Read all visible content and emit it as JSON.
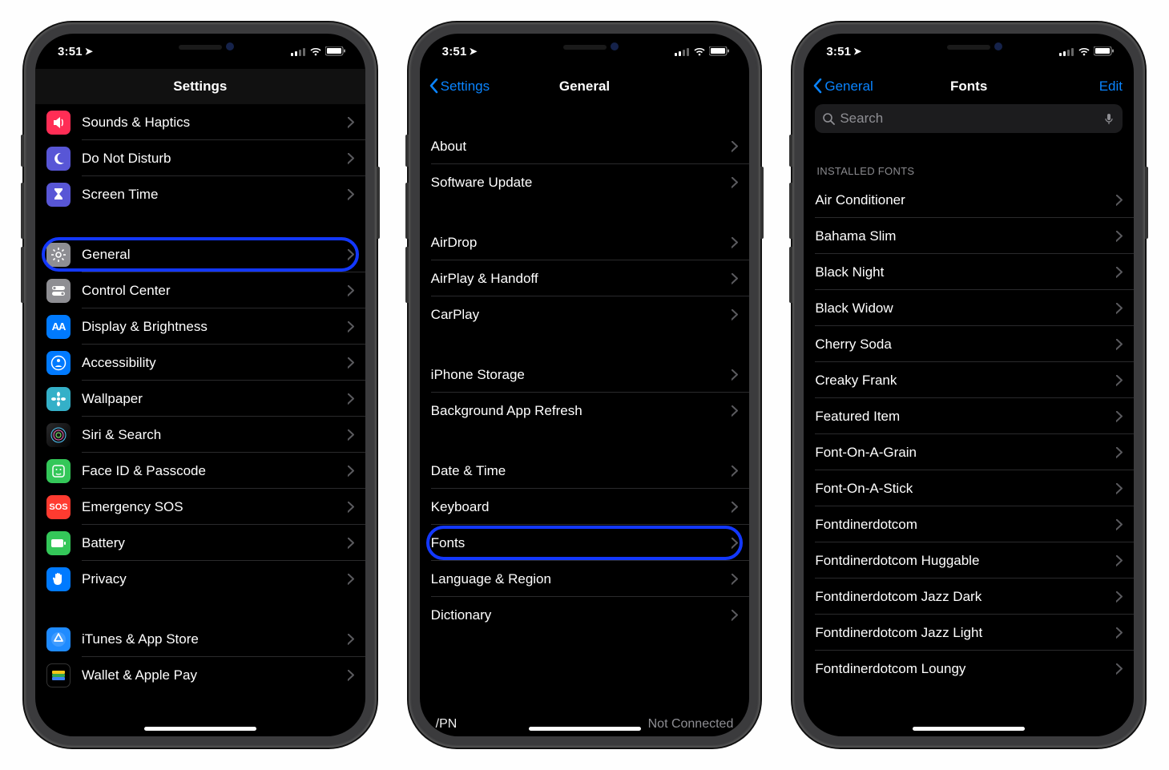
{
  "status": {
    "time": "3:51",
    "location_icon": "↗"
  },
  "phone1": {
    "title": "Settings",
    "groups": [
      {
        "rows": [
          {
            "label": "Sounds & Haptics",
            "icon": "sounds",
            "bg": "ic-sounds"
          },
          {
            "label": "Do Not Disturb",
            "icon": "moon",
            "bg": "ic-moon"
          },
          {
            "label": "Screen Time",
            "icon": "hourglass",
            "bg": "ic-hourglass"
          }
        ]
      },
      {
        "rows": [
          {
            "label": "General",
            "icon": "gear",
            "bg": "ic-gray",
            "highlight": true
          },
          {
            "label": "Control Center",
            "icon": "switches",
            "bg": "ic-gray"
          },
          {
            "label": "Display & Brightness",
            "icon": "AA",
            "bg": "ic-blue"
          },
          {
            "label": "Accessibility",
            "icon": "person",
            "bg": "ic-blue"
          },
          {
            "label": "Wallpaper",
            "icon": "flower",
            "bg": "ic-wall"
          },
          {
            "label": "Siri & Search",
            "icon": "siri",
            "bg": "ic-siri"
          },
          {
            "label": "Face ID & Passcode",
            "icon": "face",
            "bg": "ic-green"
          },
          {
            "label": "Emergency SOS",
            "icon": "SOS",
            "bg": "ic-redsos"
          },
          {
            "label": "Battery",
            "icon": "battery",
            "bg": "ic-green"
          },
          {
            "label": "Privacy",
            "icon": "hand",
            "bg": "ic-hand"
          }
        ]
      },
      {
        "rows": [
          {
            "label": "iTunes & App Store",
            "icon": "appstore",
            "bg": "ic-appstore"
          },
          {
            "label": "Wallet & Apple Pay",
            "icon": "wallet",
            "bg": "ic-wallet"
          }
        ]
      }
    ]
  },
  "phone2": {
    "back": "Settings",
    "title": "General",
    "groups": [
      {
        "rows": [
          {
            "label": "About"
          },
          {
            "label": "Software Update"
          }
        ]
      },
      {
        "rows": [
          {
            "label": "AirDrop"
          },
          {
            "label": "AirPlay & Handoff"
          },
          {
            "label": "CarPlay"
          }
        ]
      },
      {
        "rows": [
          {
            "label": "iPhone Storage"
          },
          {
            "label": "Background App Refresh"
          }
        ]
      },
      {
        "rows": [
          {
            "label": "Date & Time"
          },
          {
            "label": "Keyboard"
          },
          {
            "label": "Fonts",
            "highlight": true
          },
          {
            "label": "Language & Region"
          },
          {
            "label": "Dictionary"
          }
        ]
      }
    ],
    "clipped_left": "/PN",
    "clipped_right": "Not Connected"
  },
  "phone3": {
    "back": "General",
    "title": "Fonts",
    "edit": "Edit",
    "search_placeholder": "Search",
    "header": "INSTALLED FONTS",
    "fonts": [
      "Air Conditioner",
      "Bahama Slim",
      "Black Night",
      "Black Widow",
      "Cherry Soda",
      "Creaky Frank",
      "Featured Item",
      "Font-On-A-Grain",
      "Font-On-A-Stick",
      "Fontdinerdotcom",
      "Fontdinerdotcom Huggable",
      "Fontdinerdotcom Jazz Dark",
      "Fontdinerdotcom Jazz Light",
      "Fontdinerdotcom Loungy"
    ]
  }
}
